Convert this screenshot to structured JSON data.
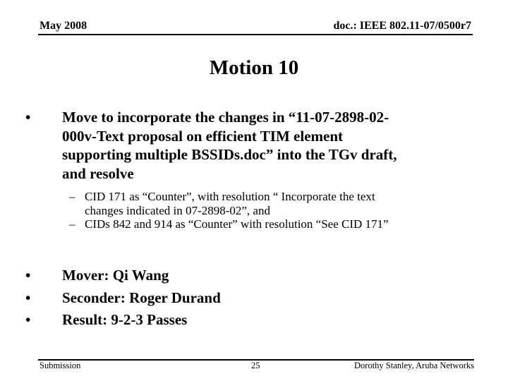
{
  "header": {
    "date": "May 2008",
    "doc_id": "doc.: IEEE 802.11-07/0500r7"
  },
  "title": "Motion 10",
  "main_bullet": {
    "symbol": "•",
    "lines": [
      "Move to incorporate the changes in “11-07-2898-02-",
      "000v-Text proposal on efficient TIM element",
      "supporting multiple BSSIDs.doc” into the TGv draft,",
      "and resolve"
    ]
  },
  "sub_bullets": [
    {
      "symbol": "–",
      "lines": [
        "CID 171 as “Counter”, with resolution “ Incorporate the text",
        "changes indicated in 07-2898-02”, and"
      ]
    },
    {
      "symbol": "–",
      "lines": [
        "CIDs 842 and 914 as “Counter” with resolution “See CID 171”"
      ]
    }
  ],
  "results": [
    {
      "symbol": "•",
      "text": "Mover: Qi Wang"
    },
    {
      "symbol": "•",
      "text": "Seconder: Roger Durand"
    },
    {
      "symbol": "•",
      "text": "Result: 9-2-3 Passes"
    }
  ],
  "footer": {
    "left": "Submission",
    "page": "25",
    "right": "Dorothy Stanley, Aruba Networks"
  }
}
